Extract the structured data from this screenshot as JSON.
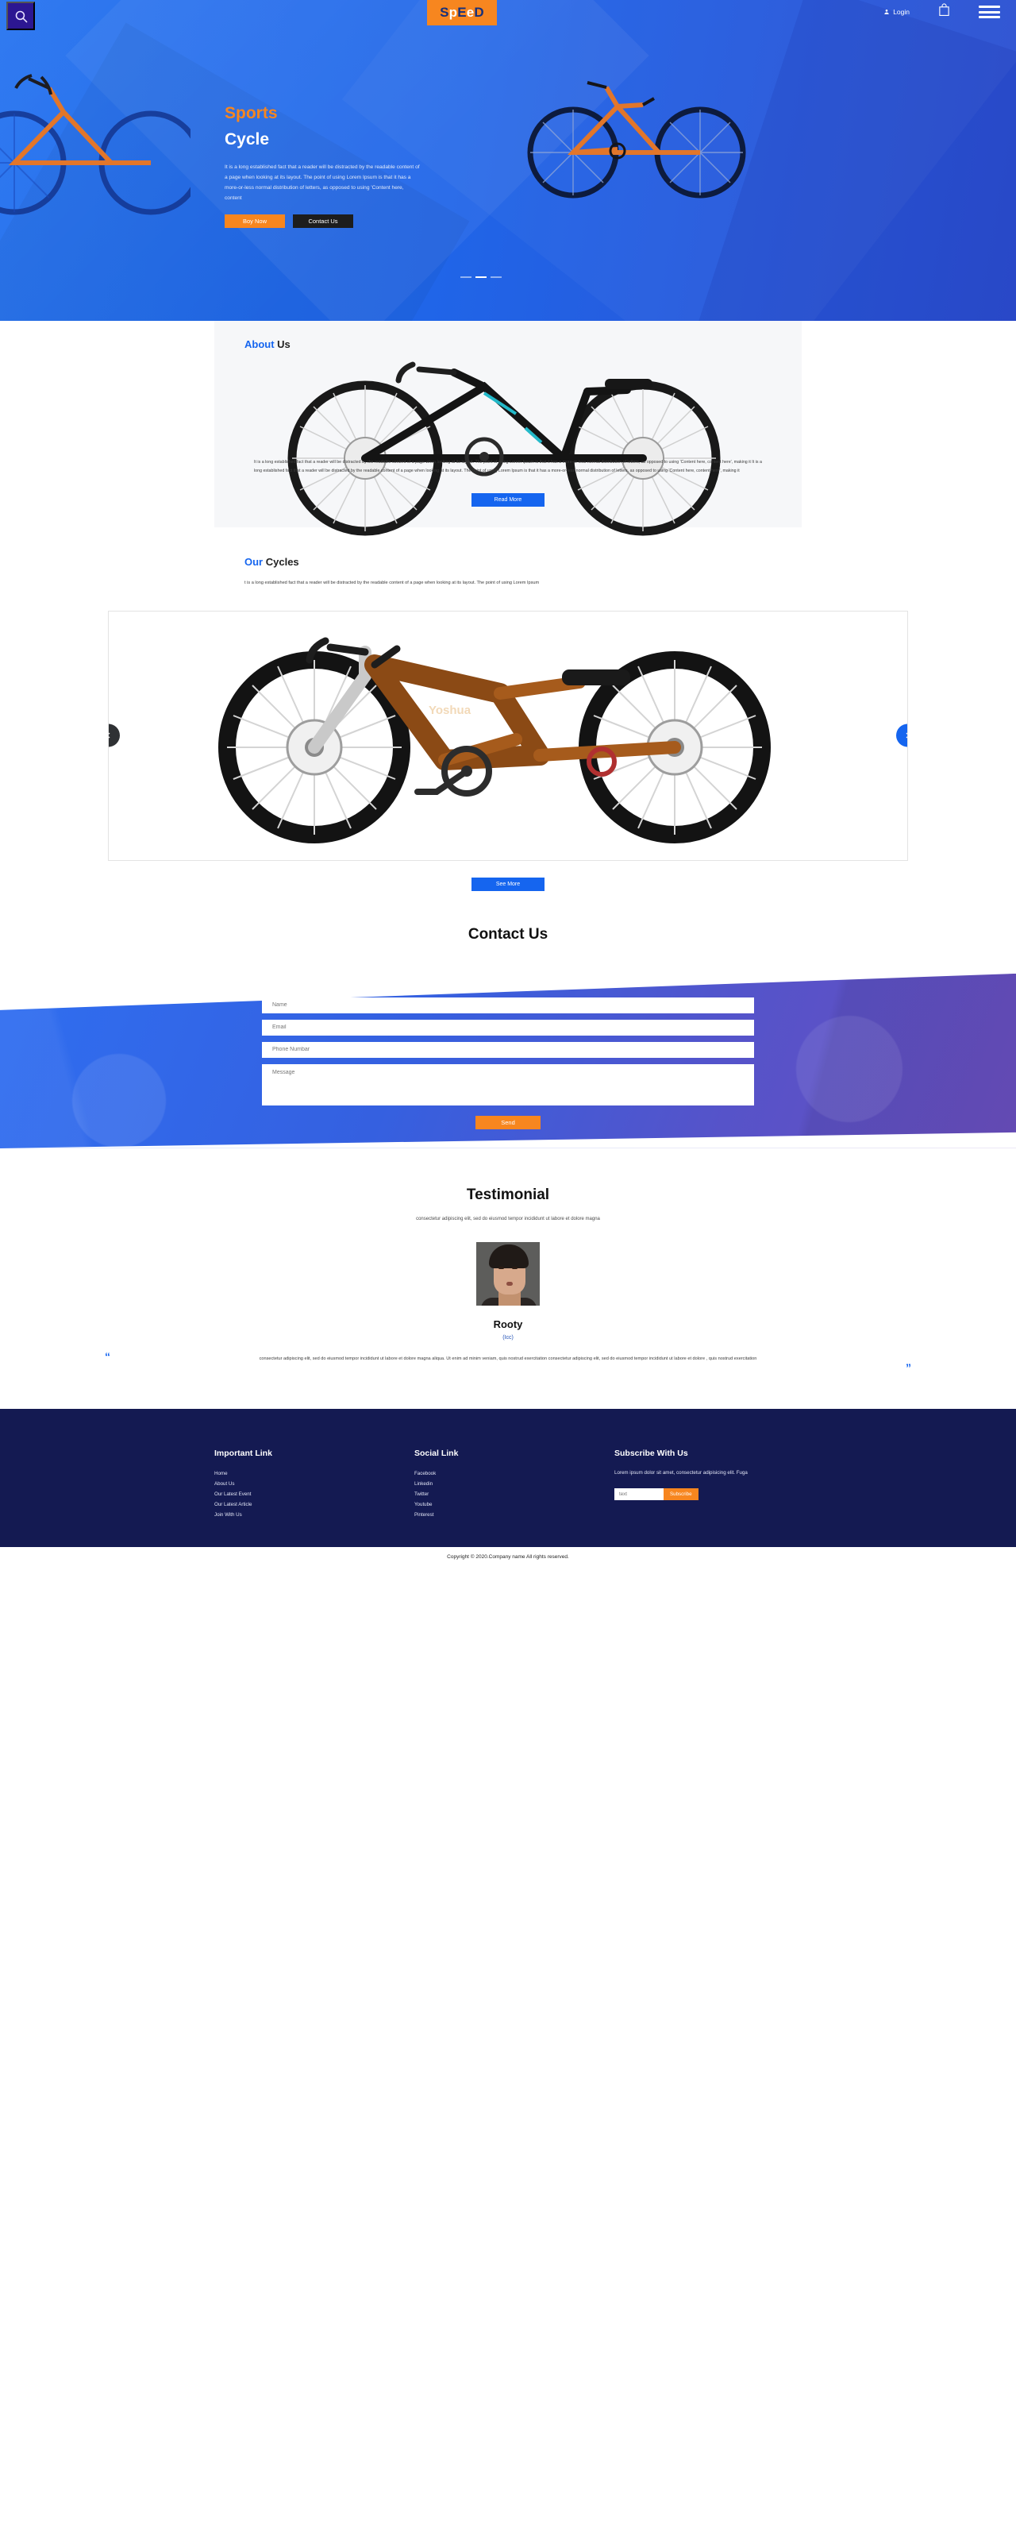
{
  "hero": {
    "search_icon": "search-icon",
    "logo": {
      "full": "SpEeD",
      "chars": [
        {
          "t": "S",
          "c": "dark"
        },
        {
          "t": "p",
          "c": "light"
        },
        {
          "t": "E",
          "c": "dark"
        },
        {
          "t": "e",
          "c": "light"
        },
        {
          "t": "D",
          "c": "dark"
        }
      ]
    },
    "login_label": "Login",
    "cart_icon": "shopping-bag-icon",
    "menu_icon": "hamburger-menu-icon",
    "kicker": "Sports",
    "title": "Cycle",
    "description": "It is a long established fact that a reader will be distracted by the readable content of a page when looking at its layout. The point of using Lorem Ipsum is that it has a more-or-less normal distribution of letters, as opposed to using 'Content here, content",
    "btn_buy": "Boy Now",
    "btn_contact": "Contact Us",
    "slide_count": 3,
    "active_slide": 2
  },
  "about": {
    "heading_accent": "About",
    "heading_rest": " Us",
    "body": "It is a long established fact that a reader will be distracted by the readable content of a page when looking at its layout. The point of using Lorem Ipsum is that it has a more-or-less normal distribution of letters, as opposed to using 'Content here, content here', making it It is a long established fact that a reader will be distracted by the readable content of a page when looking at its layout. The point of using Lorem Ipsum is that it has a more-or-less normal distribution of letters, as opposed to using 'Content here, content here', making it",
    "btn_read_more": "Read More"
  },
  "cycles": {
    "heading_accent": "Our",
    "heading_rest": " Cycles",
    "body": "t is a long established fact that a reader will be distracted by the readable content of a page when looking at its layout. The point of using Lorem Ipsum",
    "prev_icon": "chevron-left-icon",
    "next_icon": "chevron-right-icon",
    "btn_see_more": "See More"
  },
  "contact": {
    "title": "Contact Us",
    "fields": {
      "name": "Name",
      "email": "Email",
      "phone": "Phone Numbar",
      "message": "Message"
    },
    "btn_send": "Send"
  },
  "testimonial": {
    "title": "Testimonial",
    "subtitle": "consectetur adipiscing elit, sed do eiusmod tempor incididunt ut labore et dolore magna",
    "avatar": "user-avatar",
    "name": "Rooty",
    "role": "(Icc)",
    "quote_open": "“",
    "quote_close": "”",
    "quote": "consectetur adipiscing elit, sed do eiusmod tempor incididunt ut labore et dolore magna aliqua. Ut enim ad minim veniam, quis nostrud exercitation consectetur adipiscing elit, sed do eiusmod tempor incididunt ut labore et dolore , quis nostrud exercitation"
  },
  "footer": {
    "col_links": {
      "title": "Important Link",
      "items": [
        "Home",
        "About Us",
        "Our Latest Event",
        "Our Latest Article",
        "Join With Us"
      ]
    },
    "col_social": {
      "title": "Social Link",
      "items": [
        "Facebook",
        "Linkedin",
        "Twitter",
        "Youtube",
        "Pinterest"
      ]
    },
    "col_subscribe": {
      "title": "Subscribe With Us",
      "description": "Lorem ipsum dolor sit amet, consectetur adipisicing elit. Fuga",
      "input_placeholder": "text",
      "btn_label": "Subscribe"
    },
    "copyright": "Copyright © 2020.Company name All rights reserved."
  },
  "colors": {
    "primary_blue": "#1565ef",
    "hero_blue": "#2065e8",
    "orange": "#f7861f",
    "dark_navy": "#141a52",
    "logo_navy": "#16307c",
    "search_purple": "#2c1792",
    "dark_button": "#1d1d1d"
  }
}
